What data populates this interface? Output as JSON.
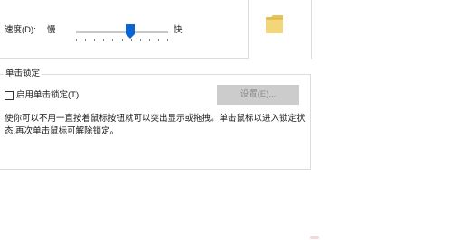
{
  "speed": {
    "label": "速度(D):",
    "slow_label": "慢",
    "fast_label": "快",
    "slider_value_fraction": 0.6,
    "tick_count": 11,
    "thumb_color": "#0a64d2"
  },
  "click_lock": {
    "group_title": "单击锁定",
    "checkbox_label": "启用单击锁定(T)",
    "checkbox_checked": false,
    "settings_button_label": "设置(E)...",
    "settings_button_enabled": false,
    "description": "使你可以不用一直按着鼠标按钮就可以突出显示或拖拽。单击鼠标以进入锁定状态,再次单击鼠标可解除锁定。"
  },
  "icons": {
    "folder": "folder-icon"
  }
}
